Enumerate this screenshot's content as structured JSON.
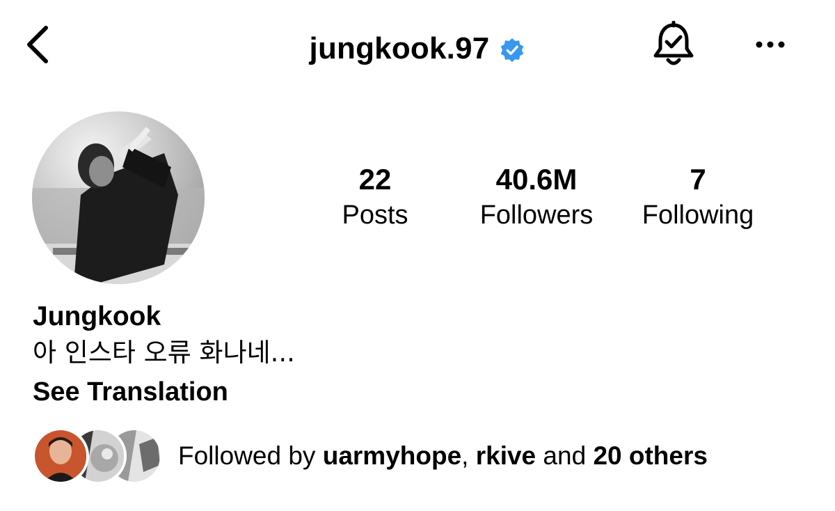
{
  "header": {
    "username": "jungkook.97",
    "back_icon": "chevron-left-icon",
    "verified_icon": "verified-badge-icon",
    "verified_color": "#3897f0",
    "bell_icon": "notification-bell-check-icon",
    "more_icon": "more-horizontal-icon"
  },
  "profile": {
    "avatar": "profile-photo",
    "stats": [
      {
        "value": "22",
        "label": "Posts"
      },
      {
        "value": "40.6M",
        "label": "Followers"
      },
      {
        "value": "7",
        "label": "Following"
      }
    ],
    "name": "Jungkook",
    "bio": "아 인스타 오류 화나네...",
    "see_translation": "See Translation"
  },
  "followed_by": {
    "prefix": "Followed by ",
    "user1": "uarmyhope",
    "separator": ", ",
    "user2": "rkive",
    "middle": " and ",
    "others": "20 others"
  }
}
